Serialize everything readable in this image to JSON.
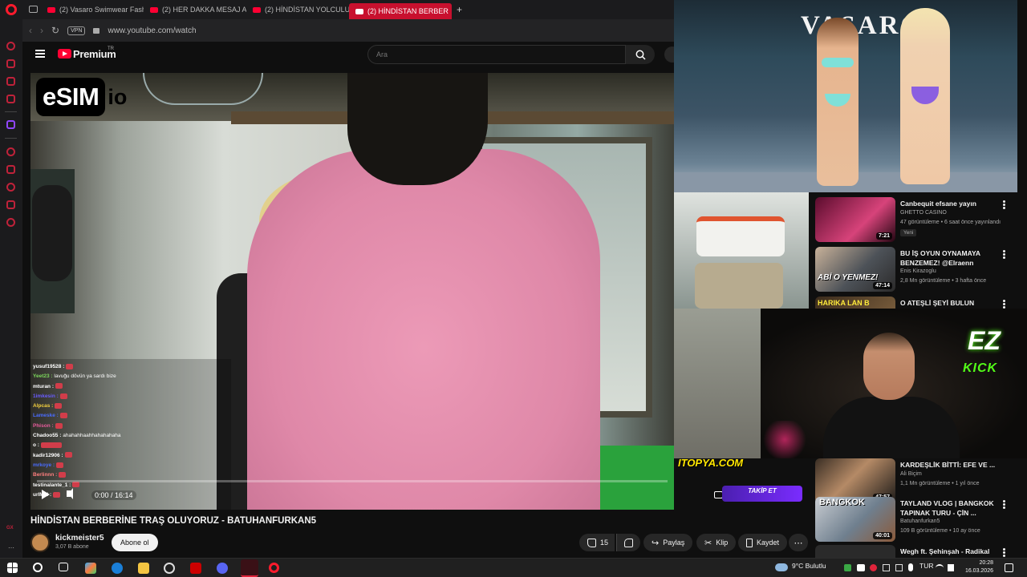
{
  "browser": {
    "tabs": [
      {
        "label": "(2) Vasaro Swimwear Fash",
        "active": false
      },
      {
        "label": "(2) HER DAKKA MESAJ AT",
        "active": false
      },
      {
        "label": "(2) HİNDİSTAN YOLCULUĞ",
        "active": false
      },
      {
        "label": "(2) HİNDİSTAN BERBER",
        "active": true
      }
    ],
    "new_tab": "+",
    "vpn_label": "VPN",
    "url": "www.youtube.com/watch"
  },
  "youtube": {
    "logo_text": "Premium",
    "logo_region": "TR",
    "search_placeholder": "Ara"
  },
  "player": {
    "watermark_main": "eSIM",
    "watermark_suffix": "io",
    "time": "0:00 / 16:14",
    "progress": 0.0,
    "overlay_brand": "ITOPYA.COM",
    "overlay_follow": "TAKİP ET",
    "chat": [
      {
        "user": "yusuf19528 :",
        "msg": "",
        "color": "#ffffff"
      },
      {
        "user": "Yeet23 :",
        "msg": "lavuğu dövün ya sardı bize",
        "color": "#7cd65c"
      },
      {
        "user": "mturan :",
        "msg": "",
        "color": "#ffffff"
      },
      {
        "user": "1imkesin :",
        "msg": "",
        "color": "#6a5cff"
      },
      {
        "user": "Alpcas :",
        "msg": "",
        "color": "#f4d03f"
      },
      {
        "user": "Lameske :",
        "msg": "",
        "color": "#4a6cff"
      },
      {
        "user": "Phison :",
        "msg": "",
        "color": "#e85c9c"
      },
      {
        "user": "Chadoo55 :",
        "msg": "ahahahhaahhahahahaha",
        "color": "#ffffff"
      },
      {
        "user": "o :",
        "msg": "",
        "color": "#ffffff"
      },
      {
        "user": "kadir12906 :",
        "msg": "",
        "color": "#ffffff"
      },
      {
        "user": "mrkoye :",
        "msg": "",
        "color": "#4a6cff"
      },
      {
        "user": "Berlinnn :",
        "msg": "",
        "color": "#ff7f7f"
      },
      {
        "user": "testinalante_1 :",
        "msg": "",
        "color": "#ffffff"
      },
      {
        "user": "urlMel :",
        "msg": "",
        "color": "#ffffff"
      }
    ]
  },
  "video": {
    "title": "HİNDİSTAN BERBERİNE TRAŞ OLUYORUZ - BATUHANFURKAN5",
    "channel": "kickmeister5",
    "subscribers": "3,07 B abone",
    "subscribe_label": "Abone ol",
    "likes": "15",
    "share_label": "Paylaş",
    "clip_label": "Klip",
    "save_label": "Kaydet"
  },
  "pip_fashion": {
    "brand": "VASARO"
  },
  "pip_webcam": {
    "logo_top": "EZ",
    "logo_bottom": "KICK"
  },
  "recommendations": [
    {
      "title": "Canbequit efsane yayın",
      "channel": "GHETTO CASINO",
      "meta": "47 görüntüleme • 6 saat önce yayınlandı",
      "badge": "Yeni",
      "duration": "7:21"
    },
    {
      "title": "BU İŞ OYUN OYNAMAYA BENZEMEZ! @Elraenn YEMEK ...",
      "channel": "Enis Kirazoglu",
      "meta": "2,8 Mn görüntüleme • 3 hafta önce",
      "badge": "",
      "duration": "47:14",
      "thumb_text": "ABİ O YENMEZ!"
    },
    {
      "title": "O ATEŞLİ ŞEYİ BULUN BANA.! & HİNDİSTAN SOKAK LEZZETLE...",
      "channel": "",
      "meta": "",
      "badge": "",
      "duration": "",
      "thumb_text": "HARIKA LAN B"
    },
    {
      "title": "KARDEŞLİK BİTTİ: EFE VE ...",
      "channel": "Ali Biçim",
      "meta": "1,1 Mn görüntüleme • 1 yıl önce",
      "badge": "",
      "duration": "47:57"
    },
    {
      "title": "TAYLAND VLOG | BANGKOK TAPINAK TURU - ÇİN ...",
      "channel": "Batuhanfurkan5",
      "meta": "109 B görüntüleme • 10 ay önce",
      "badge": "",
      "duration": "40:01",
      "thumb_text": "BANGKOK"
    },
    {
      "title": "Wegh ft. Şehinşah - Radikal",
      "channel": "",
      "meta": "",
      "badge": "",
      "duration": ""
    }
  ],
  "taskbar": {
    "weather": "9°C  Bulutlu",
    "language": "TUR",
    "time": "20:28",
    "date": "16.03.2026"
  },
  "colors": {
    "youtube_red": "#ff0033",
    "opera_red": "#c8102e",
    "kick_green": "#53fc18"
  }
}
